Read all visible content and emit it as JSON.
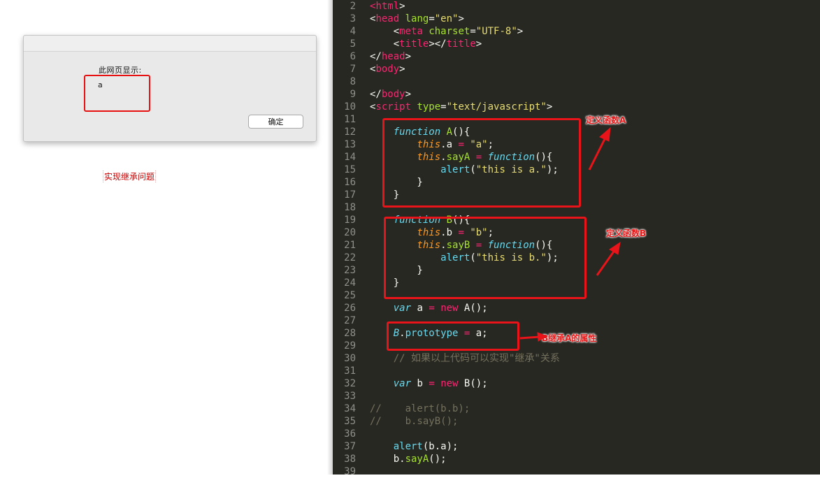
{
  "browser": {
    "alert": {
      "heading": "此网页显示:",
      "message": "a",
      "ok_label": "确定"
    },
    "page_text": "实现继承问题"
  },
  "editor": {
    "lines": [
      {
        "n": "2",
        "segments": [
          [
            "tag",
            "<"
          ],
          [
            "tag",
            "html"
          ],
          [
            "plain",
            ">"
          ]
        ]
      },
      {
        "n": "3",
        "segments": [
          [
            "plain",
            "<"
          ],
          [
            "tag",
            "head"
          ],
          [
            "plain",
            " "
          ],
          [
            "attr",
            "lang"
          ],
          [
            "plain",
            "="
          ],
          [
            "str",
            "\"en\""
          ],
          [
            "plain",
            ">"
          ]
        ]
      },
      {
        "n": "4",
        "segments": [
          [
            "plain",
            "    <"
          ],
          [
            "tag",
            "meta"
          ],
          [
            "plain",
            " "
          ],
          [
            "attr",
            "charset"
          ],
          [
            "plain",
            "="
          ],
          [
            "str",
            "\"UTF-8\""
          ],
          [
            "plain",
            ">"
          ]
        ]
      },
      {
        "n": "5",
        "segments": [
          [
            "plain",
            "    <"
          ],
          [
            "tag",
            "title"
          ],
          [
            "plain",
            "></"
          ],
          [
            "tag",
            "title"
          ],
          [
            "plain",
            ">"
          ]
        ]
      },
      {
        "n": "6",
        "segments": [
          [
            "plain",
            "</"
          ],
          [
            "tag",
            "head"
          ],
          [
            "plain",
            ">"
          ]
        ]
      },
      {
        "n": "7",
        "segments": [
          [
            "plain",
            "<"
          ],
          [
            "tag",
            "body"
          ],
          [
            "plain",
            ">"
          ]
        ]
      },
      {
        "n": "8",
        "segments": []
      },
      {
        "n": "9",
        "segments": [
          [
            "plain",
            "</"
          ],
          [
            "tag",
            "body"
          ],
          [
            "plain",
            ">"
          ]
        ]
      },
      {
        "n": "10",
        "segments": [
          [
            "plain",
            "<"
          ],
          [
            "tag",
            "script"
          ],
          [
            "plain",
            " "
          ],
          [
            "attr",
            "type"
          ],
          [
            "plain",
            "="
          ],
          [
            "str",
            "\"text/javascript\""
          ],
          [
            "plain",
            ">"
          ]
        ]
      },
      {
        "n": "11",
        "segments": []
      },
      {
        "n": "12",
        "segments": [
          [
            "plain",
            "    "
          ],
          [
            "kw",
            "function"
          ],
          [
            "plain",
            " "
          ],
          [
            "fn",
            "A"
          ],
          [
            "plain",
            "(){"
          ]
        ]
      },
      {
        "n": "13",
        "segments": [
          [
            "plain",
            "        "
          ],
          [
            "this",
            "this"
          ],
          [
            "plain",
            ".a "
          ],
          [
            "op",
            "="
          ],
          [
            "plain",
            " "
          ],
          [
            "str",
            "\"a\""
          ],
          [
            "plain",
            ";"
          ]
        ]
      },
      {
        "n": "14",
        "segments": [
          [
            "plain",
            "        "
          ],
          [
            "this",
            "this"
          ],
          [
            "plain",
            "."
          ],
          [
            "fn",
            "sayA"
          ],
          [
            "plain",
            " "
          ],
          [
            "op",
            "="
          ],
          [
            "plain",
            " "
          ],
          [
            "kw",
            "function"
          ],
          [
            "plain",
            "(){"
          ]
        ]
      },
      {
        "n": "15",
        "segments": [
          [
            "plain",
            "            "
          ],
          [
            "builtin",
            "alert"
          ],
          [
            "plain",
            "("
          ],
          [
            "str",
            "\"this is a.\""
          ],
          [
            "plain",
            ");"
          ]
        ]
      },
      {
        "n": "16",
        "segments": [
          [
            "plain",
            "        }"
          ]
        ]
      },
      {
        "n": "17",
        "segments": [
          [
            "plain",
            "    }"
          ]
        ]
      },
      {
        "n": "18",
        "segments": []
      },
      {
        "n": "19",
        "segments": [
          [
            "plain",
            "    "
          ],
          [
            "kw",
            "function"
          ],
          [
            "plain",
            " "
          ],
          [
            "fn",
            "B"
          ],
          [
            "plain",
            "(){"
          ]
        ]
      },
      {
        "n": "20",
        "segments": [
          [
            "plain",
            "        "
          ],
          [
            "this",
            "this"
          ],
          [
            "plain",
            ".b "
          ],
          [
            "op",
            "="
          ],
          [
            "plain",
            " "
          ],
          [
            "str",
            "\"b\""
          ],
          [
            "plain",
            ";"
          ]
        ]
      },
      {
        "n": "21",
        "segments": [
          [
            "plain",
            "        "
          ],
          [
            "this",
            "this"
          ],
          [
            "plain",
            "."
          ],
          [
            "fn",
            "sayB"
          ],
          [
            "plain",
            " "
          ],
          [
            "op",
            "="
          ],
          [
            "plain",
            " "
          ],
          [
            "kw",
            "function"
          ],
          [
            "plain",
            "(){"
          ]
        ]
      },
      {
        "n": "22",
        "segments": [
          [
            "plain",
            "            "
          ],
          [
            "builtin",
            "alert"
          ],
          [
            "plain",
            "("
          ],
          [
            "str",
            "\"this is b.\""
          ],
          [
            "plain",
            ");"
          ]
        ]
      },
      {
        "n": "23",
        "segments": [
          [
            "plain",
            "        }"
          ]
        ]
      },
      {
        "n": "24",
        "segments": [
          [
            "plain",
            "    }"
          ]
        ]
      },
      {
        "n": "25",
        "segments": []
      },
      {
        "n": "26",
        "segments": [
          [
            "plain",
            "    "
          ],
          [
            "kw",
            "var"
          ],
          [
            "plain",
            " a "
          ],
          [
            "op",
            "="
          ],
          [
            "plain",
            " "
          ],
          [
            "op",
            "new"
          ],
          [
            "plain",
            " A();"
          ]
        ]
      },
      {
        "n": "27",
        "segments": []
      },
      {
        "n": "28",
        "segments": [
          [
            "plain",
            "    "
          ],
          [
            "cls",
            "B"
          ],
          [
            "plain",
            "."
          ],
          [
            "builtin",
            "prototype"
          ],
          [
            "plain",
            " "
          ],
          [
            "op",
            "="
          ],
          [
            "plain",
            " a;"
          ]
        ]
      },
      {
        "n": "29",
        "segments": []
      },
      {
        "n": "30",
        "segments": [
          [
            "plain",
            "    "
          ],
          [
            "cmt",
            "// 如果以上代码可以实现\"继承\"关系"
          ]
        ]
      },
      {
        "n": "31",
        "segments": []
      },
      {
        "n": "32",
        "segments": [
          [
            "plain",
            "    "
          ],
          [
            "kw",
            "var"
          ],
          [
            "plain",
            " b "
          ],
          [
            "op",
            "="
          ],
          [
            "plain",
            " "
          ],
          [
            "op",
            "new"
          ],
          [
            "plain",
            " B();"
          ]
        ]
      },
      {
        "n": "33",
        "segments": []
      },
      {
        "n": "34",
        "segments": [
          [
            "cmt",
            "//    alert(b.b);"
          ]
        ]
      },
      {
        "n": "35",
        "segments": [
          [
            "cmt",
            "//    b.sayB();"
          ]
        ]
      },
      {
        "n": "36",
        "segments": []
      },
      {
        "n": "37",
        "segments": [
          [
            "plain",
            "    "
          ],
          [
            "builtin",
            "alert"
          ],
          [
            "plain",
            "(b.a);"
          ]
        ]
      },
      {
        "n": "38",
        "segments": [
          [
            "plain",
            "    b."
          ],
          [
            "fn",
            "sayA"
          ],
          [
            "plain",
            "();"
          ]
        ]
      },
      {
        "n": "39",
        "segments": []
      }
    ]
  },
  "annotations": {
    "define_a": "定义函数A",
    "define_b": "定义函数B",
    "b_inherits_a": "B继承A的属性"
  },
  "colors": {
    "editor_bg": "#272822",
    "annotation_red": "#e8141a",
    "tag": "#f92672",
    "keyword": "#66d9ef",
    "string": "#e6db74",
    "function_name": "#a6e22e",
    "this_keyword": "#fd971f",
    "comment": "#75715e"
  }
}
